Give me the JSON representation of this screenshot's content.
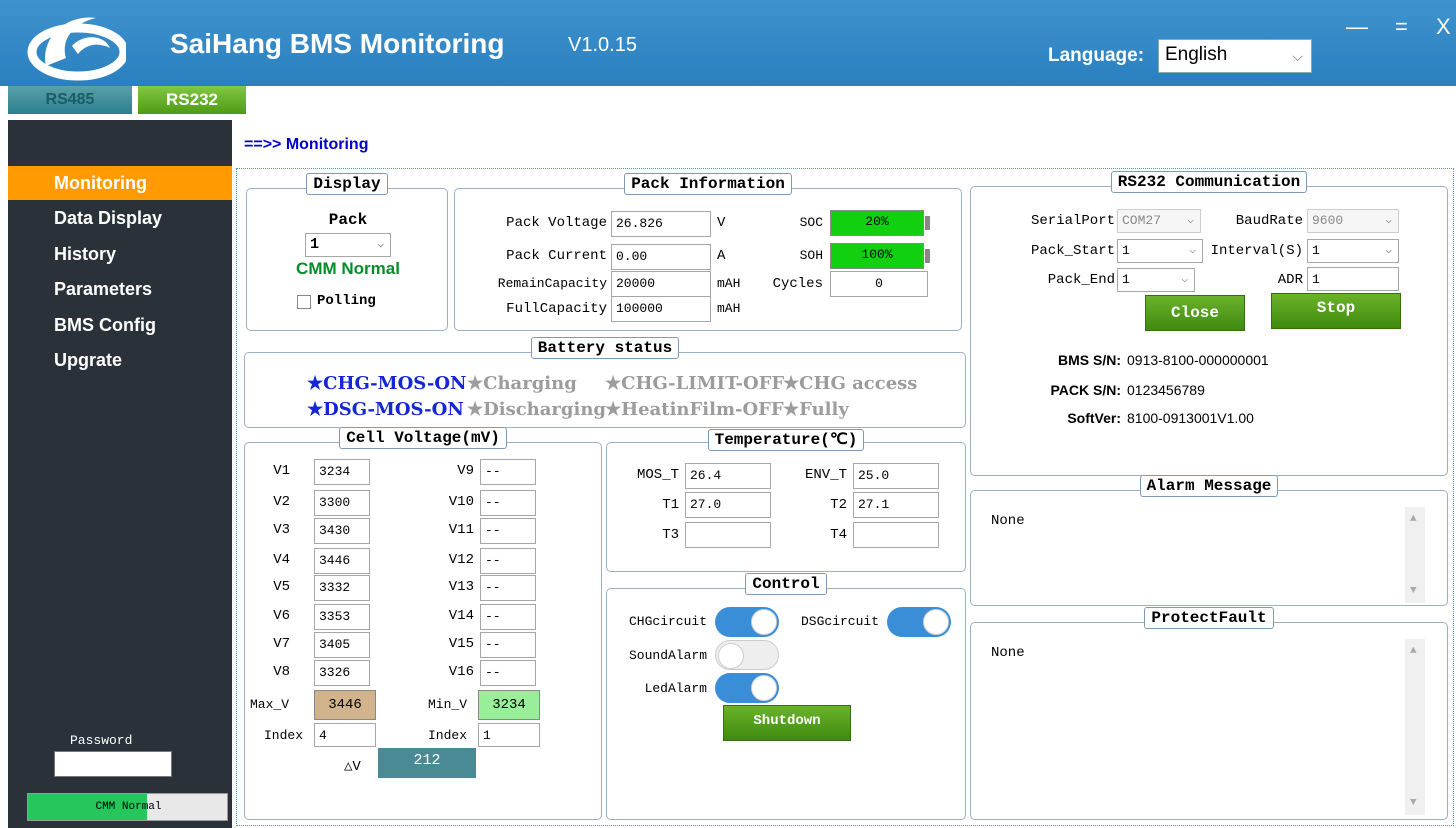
{
  "header": {
    "title": "SaiHang BMS Monitoring",
    "version": "V1.0.15",
    "language_label": "Language:",
    "language_value": "English",
    "window_controls": {
      "minimize": "—",
      "maximize": "=",
      "close": "X"
    }
  },
  "tabs": [
    {
      "label": "RS485",
      "active": false
    },
    {
      "label": "RS232",
      "active": true
    }
  ],
  "sidebar": {
    "items": [
      {
        "label": "Monitoring",
        "active": true
      },
      {
        "label": "Data Display"
      },
      {
        "label": "History"
      },
      {
        "label": "Parameters"
      },
      {
        "label": "BMS Config"
      },
      {
        "label": "Upgrate"
      }
    ],
    "password_label": "Password",
    "password_value": "",
    "status_text": "CMM Normal",
    "status_progress_pct": 60,
    "status_color": "#25c75c"
  },
  "breadcrumb": "==>> Monitoring",
  "display": {
    "title": "Display",
    "pack_label": "Pack",
    "pack_value": "1",
    "comm_status": "CMM Normal",
    "polling_label": "Polling",
    "polling_checked": false
  },
  "pack_info": {
    "title": "Pack Information",
    "voltage_label": "Pack Voltage",
    "voltage": "26.826",
    "voltage_unit": "V",
    "current_label": "Pack Current",
    "current": "0.00",
    "current_unit": "A",
    "remain_label": "RemainCapacity",
    "remain": "20000",
    "remain_unit": "mAH",
    "full_label": "FullCapacity",
    "full": "100000",
    "full_unit": "mAH",
    "soc_label": "SOC",
    "soc": "20%",
    "soc_pct": 100,
    "soh_label": "SOH",
    "soh": "100%",
    "soh_pct": 100,
    "cycles_label": "Cycles",
    "cycles": "0"
  },
  "battery_status": {
    "title": "Battery status",
    "row1": [
      {
        "label": "★CHG-MOS-ON",
        "active": true
      },
      {
        "label": "★Charging",
        "active": false
      },
      {
        "label": "★CHG-LIMIT-OFF",
        "active": false
      },
      {
        "label": "★CHG access",
        "active": false
      }
    ],
    "row2": [
      {
        "label": "★DSG-MOS-ON",
        "active": true
      },
      {
        "label": "★Discharging",
        "active": false
      },
      {
        "label": "★HeatinFilm-OFF",
        "active": false
      },
      {
        "label": "★Fully",
        "active": false
      }
    ]
  },
  "cell_voltage": {
    "title": "Cell Voltage(mV)",
    "left": [
      {
        "label": "V1",
        "value": "3234"
      },
      {
        "label": "V2",
        "value": "3300"
      },
      {
        "label": "V3",
        "value": "3430"
      },
      {
        "label": "V4",
        "value": "3446"
      },
      {
        "label": "V5",
        "value": "3332"
      },
      {
        "label": "V6",
        "value": "3353"
      },
      {
        "label": "V7",
        "value": "3405"
      },
      {
        "label": "V8",
        "value": "3326"
      }
    ],
    "right": [
      {
        "label": "V9",
        "value": "--"
      },
      {
        "label": "V10",
        "value": "--"
      },
      {
        "label": "V11",
        "value": "--"
      },
      {
        "label": "V12",
        "value": "--"
      },
      {
        "label": "V13",
        "value": "--"
      },
      {
        "label": "V14",
        "value": "--"
      },
      {
        "label": "V15",
        "value": "--"
      },
      {
        "label": "V16",
        "value": "--"
      }
    ],
    "max_label": "Max_V",
    "max_value": "3446",
    "max_color": "#d2b48c",
    "min_label": "Min_V",
    "min_value": "3234",
    "min_color": "#99ee99",
    "max_index_label": "Index",
    "max_index": "4",
    "min_index_label": "Index",
    "min_index": "1",
    "delta_label": "△V",
    "delta_value": "212",
    "delta_color": "#4a8a94"
  },
  "temperature": {
    "title": "Temperature(℃)",
    "mos_label": "MOS_T",
    "mos": "26.4",
    "env_label": "ENV_T",
    "env": "25.0",
    "t1_label": "T1",
    "t1": "27.0",
    "t2_label": "T2",
    "t2": "27.1",
    "t3_label": "T3",
    "t3": "",
    "t4_label": "T4",
    "t4": ""
  },
  "control": {
    "title": "Control",
    "chg_label": "CHGcircuit",
    "chg_on": true,
    "dsg_label": "DSGcircuit",
    "dsg_on": true,
    "sound_label": "SoundAlarm",
    "sound_on": false,
    "led_label": "LedAlarm",
    "led_on": true,
    "shutdown_label": "Shutdown"
  },
  "rs232": {
    "title": "RS232 Communication",
    "serial_label": "SerialPort",
    "serial_value": "COM27",
    "baud_label": "BaudRate",
    "baud_value": "9600",
    "pack_start_label": "Pack_Start",
    "pack_start": "1",
    "interval_label": "Interval(S)",
    "interval": "1",
    "pack_end_label": "Pack_End",
    "pack_end": "1",
    "adr_label": "ADR",
    "adr": "1",
    "close_label": "Close",
    "stop_label": "Stop",
    "bms_sn_label": "BMS S/N:",
    "bms_sn": "0913-8100-000000001",
    "pack_sn_label": "PACK S/N:",
    "pack_sn": "0123456789",
    "softver_label": "SoftVer:",
    "softver": "8100-0913001V1.00"
  },
  "alarm": {
    "title": "Alarm Message",
    "text": "None"
  },
  "protect": {
    "title": "ProtectFault",
    "text": "None"
  }
}
